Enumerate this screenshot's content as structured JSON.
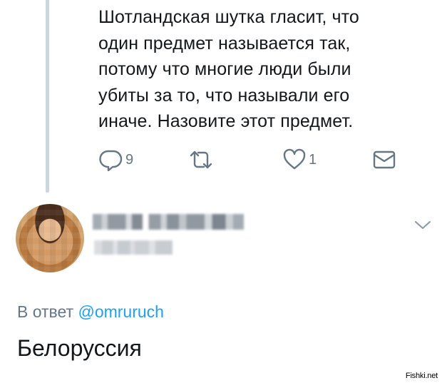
{
  "tweet": {
    "text": "Шотландская шутка гласит, что\nодин предмет называется так,\nпотому что многие люди были\nубиты за то, что называли его\nиначе. Назовите этот предмет."
  },
  "actions": {
    "reply_count": "9",
    "retweet_count": "",
    "like_count": "1",
    "icons": [
      "reply-icon",
      "retweet-icon",
      "like-icon",
      "direct-message-icon"
    ]
  },
  "reply": {
    "reply_to_prefix": "В ответ",
    "mention": "@omruruch",
    "text": "Белоруссия"
  },
  "watermark": "Fishki.net",
  "colors": {
    "text": "#14171a",
    "secondary": "#657786",
    "link": "#1da1f2",
    "thread_line": "#ccd6dd"
  }
}
